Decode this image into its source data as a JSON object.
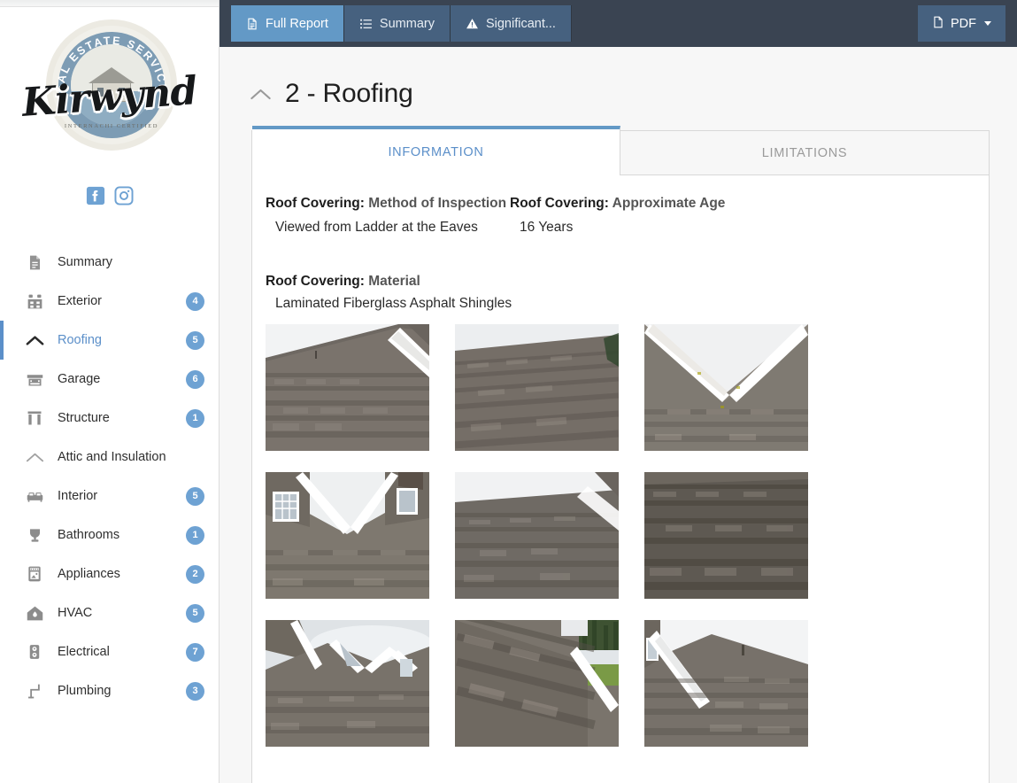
{
  "brand": {
    "logo_arc_text": "REAL ESTATE SERVICES",
    "logo_script": "Kirwynd",
    "logo_certification": "INTERNACHI CERTIFIED",
    "social": [
      {
        "name": "facebook-icon",
        "label": "Facebook"
      },
      {
        "name": "instagram-icon",
        "label": "Instagram"
      }
    ]
  },
  "topbar": {
    "buttons": [
      {
        "id": "full-report",
        "label": "Full Report",
        "icon": "document-icon",
        "selected": true
      },
      {
        "id": "summary",
        "label": "Summary",
        "icon": "list-icon",
        "selected": false
      },
      {
        "id": "significant",
        "label": "Significant...",
        "icon": "warning-triangle-icon",
        "selected": false
      }
    ],
    "pdf_button": {
      "label": "PDF",
      "icon": "pdf-file-icon"
    },
    "accent_selected": "#6399c6",
    "accent_unselected": "#46617f",
    "bar_background": "#3a4452"
  },
  "sidebar": {
    "items": [
      {
        "label": "Summary",
        "icon": "document-icon",
        "badge": "",
        "active": false
      },
      {
        "label": "Exterior",
        "icon": "building-icon",
        "badge": "4",
        "active": false
      },
      {
        "label": "Roofing",
        "icon": "roof-icon",
        "badge": "5",
        "active": true
      },
      {
        "label": "Garage",
        "icon": "garage-icon",
        "badge": "6",
        "active": false
      },
      {
        "label": "Structure",
        "icon": "structure-icon",
        "badge": "1",
        "active": false
      },
      {
        "label": "Attic and Insulation",
        "icon": "attic-icon",
        "badge": "",
        "active": false
      },
      {
        "label": "Interior",
        "icon": "sofa-icon",
        "badge": "5",
        "active": false
      },
      {
        "label": "Bathrooms",
        "icon": "toilet-icon",
        "badge": "1",
        "active": false
      },
      {
        "label": "Appliances",
        "icon": "oven-icon",
        "badge": "2",
        "active": false
      },
      {
        "label": "HVAC",
        "icon": "furnace-icon",
        "badge": "5",
        "active": false
      },
      {
        "label": "Electrical",
        "icon": "outlet-icon",
        "badge": "7",
        "active": false
      },
      {
        "label": "Plumbing",
        "icon": "pipe-icon",
        "badge": "3",
        "active": false
      }
    ],
    "badge_color": "#6ea2d3",
    "active_color": "#5b8fc9"
  },
  "main": {
    "page_title": "2 - Roofing",
    "page_icon": "roof-icon",
    "tabs": [
      {
        "label": "INFORMATION",
        "active": true
      },
      {
        "label": "LIMITATIONS",
        "active": false
      }
    ],
    "fields": [
      {
        "label_prefix": "Roof Covering: ",
        "label_rest": "Method of Inspection",
        "value": "Viewed from Ladder at the Eaves"
      },
      {
        "label_prefix": "Roof Covering: ",
        "label_rest": "Approximate Age",
        "value": "16 Years"
      }
    ],
    "material": {
      "label_prefix": "Roof Covering: ",
      "label_rest": "Material",
      "value": "Laminated Fiberglass Asphalt Shingles"
    },
    "photos": [
      {
        "alt": "Roof slope with white fascia trim and asphalt shingles",
        "variant": "a"
      },
      {
        "alt": "Close view up the roof slope of asphalt shingles",
        "variant": "b"
      },
      {
        "alt": "Valley between two dormer gables with white trim",
        "variant": "c"
      },
      {
        "alt": "Dormer windows with shake siding and shingle valley",
        "variant": "d"
      },
      {
        "alt": "Roof slope with white fascia and sky",
        "variant": "e"
      },
      {
        "alt": "Dark asphalt shingle field close up",
        "variant": "f"
      },
      {
        "alt": "Gable dormers against cloudy sky",
        "variant": "g"
      },
      {
        "alt": "Roof edge with lawn and trees in background",
        "variant": "h"
      },
      {
        "alt": "Roof ridge and white barge board against sky",
        "variant": "i"
      }
    ]
  }
}
